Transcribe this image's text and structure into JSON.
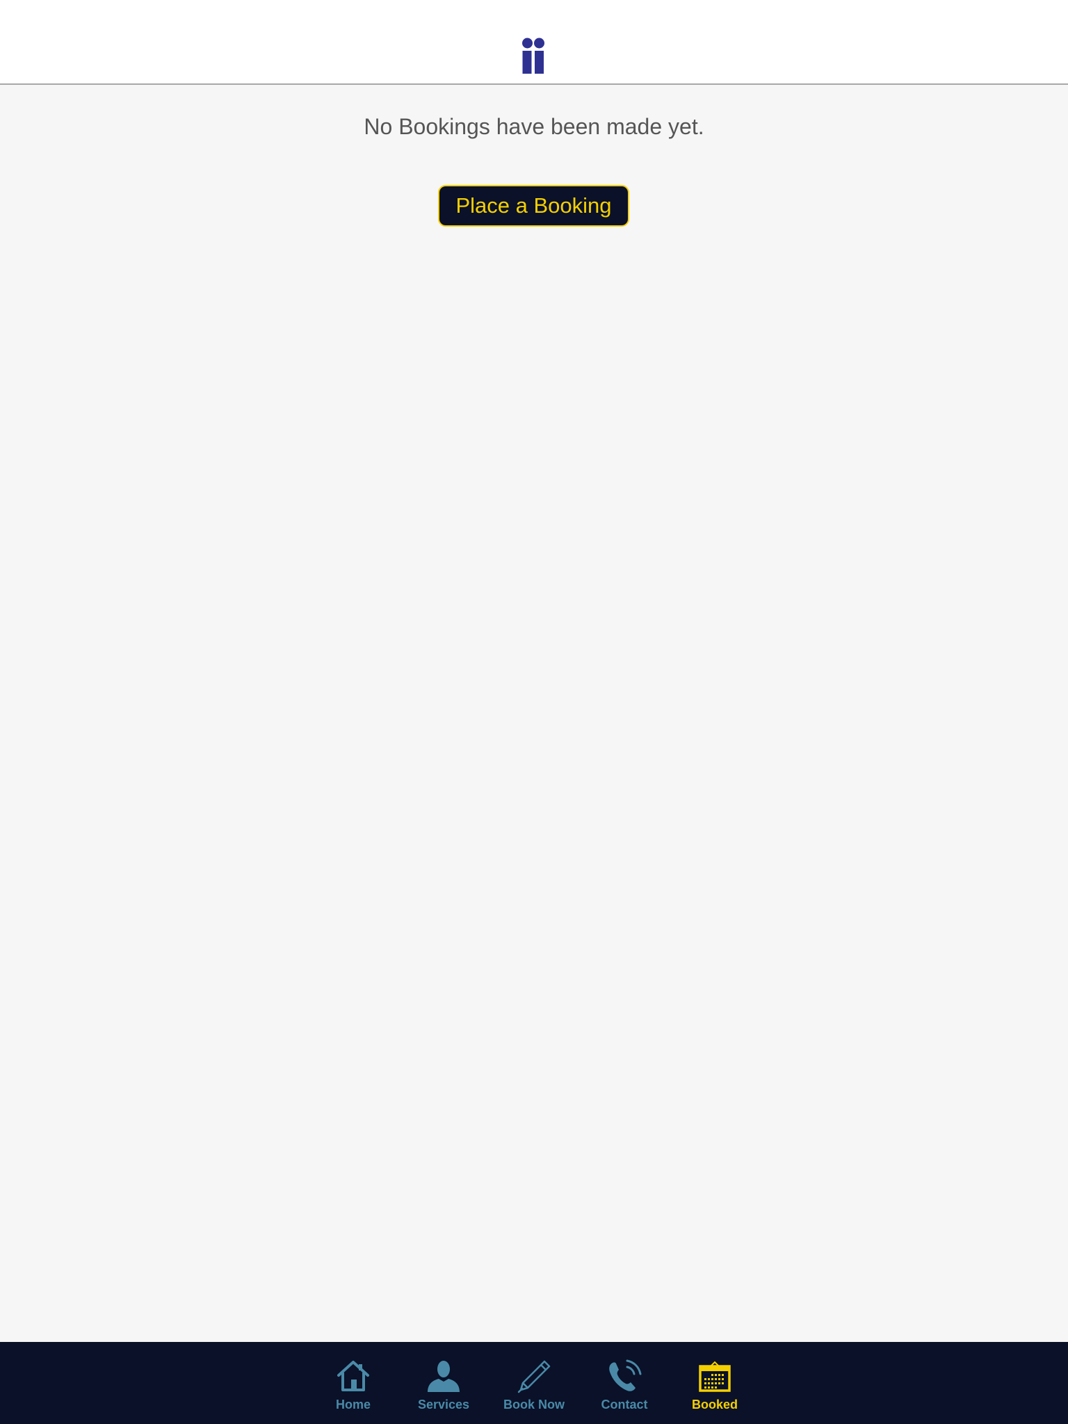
{
  "colors": {
    "brand_navy": "#0a1128",
    "accent_yellow": "#f5d000",
    "tab_inactive": "#4a8aa8",
    "logo": "#2e3191",
    "background": "#f6f6f6"
  },
  "header": {
    "logo_icon": "two-people-logo-icon"
  },
  "main": {
    "empty_message": "No Bookings have been made yet.",
    "place_booking_label": "Place a Booking"
  },
  "tabbar": {
    "active": "booked",
    "items": [
      {
        "id": "home",
        "label": "Home",
        "icon": "home-icon"
      },
      {
        "id": "services",
        "label": "Services",
        "icon": "person-icon"
      },
      {
        "id": "book_now",
        "label": "Book Now",
        "icon": "pencil-icon"
      },
      {
        "id": "contact",
        "label": "Contact",
        "icon": "phone-icon"
      },
      {
        "id": "booked",
        "label": "Booked",
        "icon": "calendar-icon"
      }
    ]
  }
}
